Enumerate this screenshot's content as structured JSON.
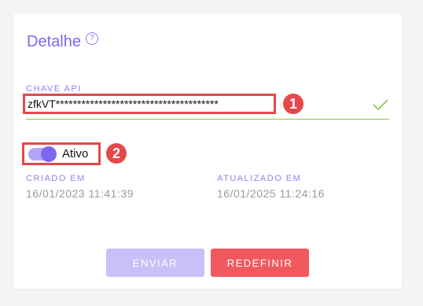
{
  "form": {
    "title": "Detalhe",
    "help_icon": "?",
    "api_key": {
      "label": "CHAVE API",
      "value": "zfkVT**************************************",
      "valid_icon": "check-icon"
    },
    "active": {
      "label": "Ativo",
      "enabled": true
    },
    "created": {
      "label": "CRIADO EM",
      "value": "16/01/2023 11:41:39"
    },
    "updated": {
      "label": "ATUALIZADO EM",
      "value": "16/01/2025 11:24:16"
    },
    "buttons": {
      "send": "ENVIAR",
      "reset": "REDEFINIR"
    }
  },
  "annotations": {
    "badge_1": "1",
    "badge_2": "2"
  },
  "colors": {
    "accent": "#7b68ee",
    "accent_light": "#c8c0f8",
    "danger": "#f05a5f",
    "success": "#8bc34a",
    "annotation": "#e5474b"
  }
}
